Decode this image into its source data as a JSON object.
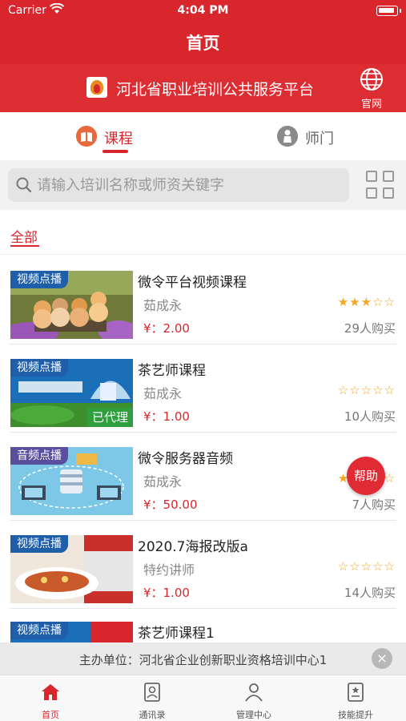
{
  "status_bar": {
    "carrier": "Carrier",
    "time": "4:04 PM"
  },
  "nav": {
    "title": "首页"
  },
  "platform": {
    "name": "河北省职业培训公共服务平台",
    "official_site_label": "官网"
  },
  "tabs": [
    {
      "label": "课程",
      "active": true,
      "icon": "book-icon"
    },
    {
      "label": "师门",
      "active": false,
      "icon": "person-icon"
    }
  ],
  "search": {
    "placeholder": "请输入培训名称或师资关键字",
    "value": ""
  },
  "filter": {
    "label": "全部"
  },
  "courses": [
    {
      "tag": "视频点播",
      "title": "微令平台视频课程",
      "author": "茹成永",
      "price": "¥：2.00",
      "rating": 3,
      "buyers": "29人购买",
      "badge": ""
    },
    {
      "tag": "视频点播",
      "title": "茶艺师课程",
      "author": "茹成永",
      "price": "¥：1.00",
      "rating": 0,
      "buyers": "10人购买",
      "badge": "已代理"
    },
    {
      "tag": "音频点播",
      "title": "微令服务器音频",
      "author": "茹成永",
      "price": "¥：50.00",
      "rating": 1,
      "buyers": "7人购买",
      "badge": ""
    },
    {
      "tag": "视频点播",
      "title": "2020.7海报改版a",
      "author": "特约讲师",
      "price": "¥：1.00",
      "rating": 0,
      "buyers": "14人购买",
      "badge": ""
    },
    {
      "tag": "视频点播",
      "title": "茶艺师课程1",
      "author": "",
      "price": "",
      "rating": 0,
      "buyers": "",
      "badge": ""
    }
  ],
  "help_button": {
    "label": "帮助"
  },
  "sponsor": {
    "text": "主办单位：河北省企业创新职业资格培训中心1",
    "close": "×"
  },
  "bottom_nav": [
    {
      "label": "首页",
      "icon": "home-icon",
      "active": true
    },
    {
      "label": "通讯录",
      "icon": "contacts-icon",
      "active": false
    },
    {
      "label": "管理中心",
      "icon": "user-icon",
      "active": false
    },
    {
      "label": "技能提升",
      "icon": "certificate-icon",
      "active": false
    }
  ],
  "colors": {
    "brand_red": "#d9262d",
    "star": "#f5a623",
    "tag_blue": "#1f5ea8",
    "tag_purple": "#5a4f9e",
    "badge_green": "#2f9e3f"
  }
}
